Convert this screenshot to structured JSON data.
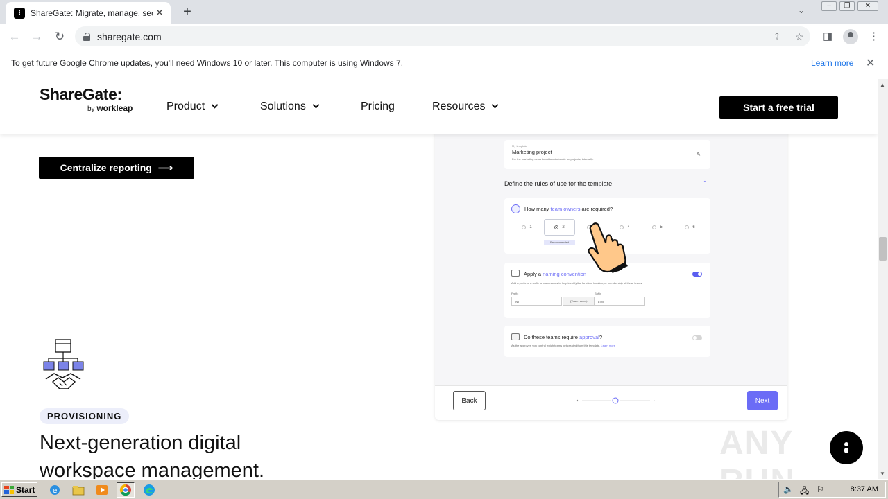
{
  "browser": {
    "tab_title": "ShareGate: Migrate, manage, secure",
    "favicon_glyph": "⁝",
    "url": "sharegate.com",
    "infobar_text": "To get future Google Chrome updates, you'll need Windows 10 or later. This computer is using Windows 7.",
    "infobar_link": "Learn more"
  },
  "site": {
    "logo_main": "ShareGate:",
    "logo_by": "by",
    "logo_sub": "workleap",
    "nav": [
      {
        "label": "Product"
      },
      {
        "label": "Solutions"
      },
      {
        "label": "Pricing"
      },
      {
        "label": "Resources"
      }
    ],
    "trial_button": "Start a free trial",
    "cta_button": "Centralize reporting",
    "cta_arrow": "⟶",
    "badge": "PROVISIONING",
    "headline": "Next-generation digital workspace management."
  },
  "mockup": {
    "template_label": "My template",
    "project_title": "Marketing project",
    "project_desc": "For the marketing department to collaborate on projects, internally.",
    "rules_title": "Define the rules of use for the template",
    "owners_question_a": "How many ",
    "owners_question_link": "team owners",
    "owners_question_b": " are required?",
    "owner_options": [
      "1",
      "2",
      "3",
      "4",
      "5",
      "6"
    ],
    "recommended": "Recommended",
    "naming_title_a": "Apply a ",
    "naming_title_link": "naming convention",
    "naming_desc": "Add a prefix or a suffix to team names to help identify the function, location, or membership of these teams.",
    "prefix_label": "Prefix",
    "prefix_value": "INT",
    "team_name_token": "-[Team name]-",
    "suffix_label": "Suffix",
    "suffix_value": "LTM",
    "approval_title_a": "Do these teams require ",
    "approval_title_link": "approval",
    "approval_title_b": "?",
    "approval_desc": "As the approver, you control which teams get created from this template.",
    "approval_link": "Learn more",
    "back_button": "Back",
    "next_button": "Next",
    "accent_color": "#6b6cf6"
  },
  "watermark": "ANY RUN",
  "taskbar": {
    "start_label": "Start",
    "clock": "8:37 AM"
  }
}
